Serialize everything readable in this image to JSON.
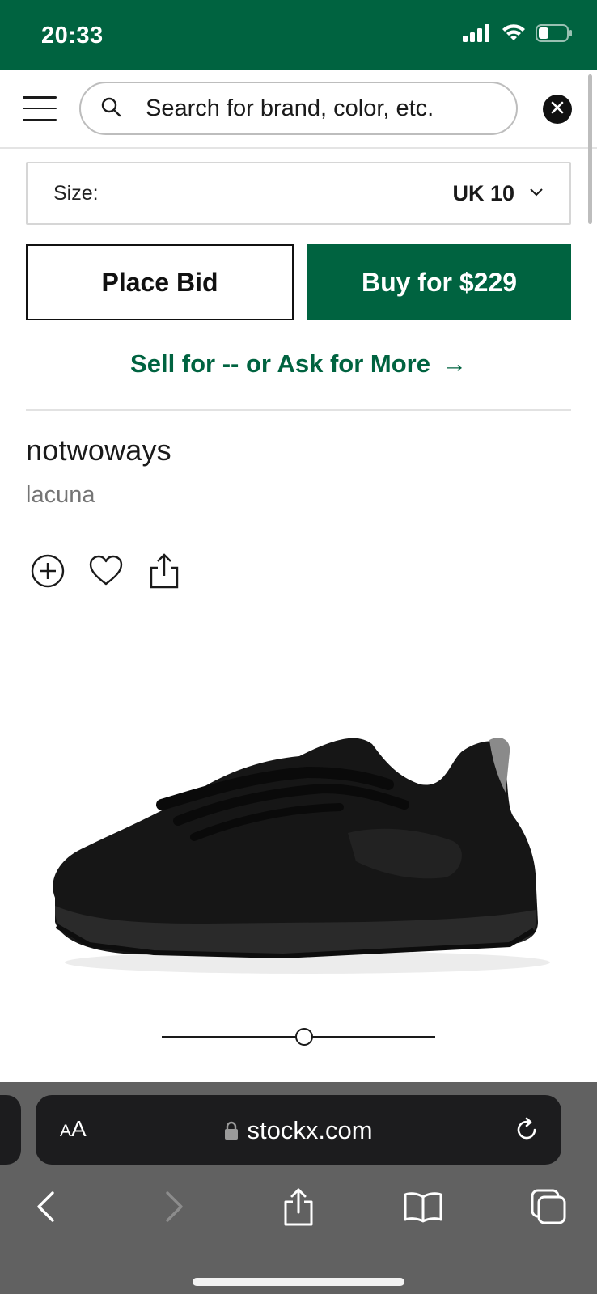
{
  "status_bar": {
    "time": "20:33",
    "icons": [
      "signal-icon",
      "wifi-icon",
      "battery-icon"
    ],
    "background": "#006340"
  },
  "header": {
    "search_placeholder": "Search for brand, color, etc.",
    "icons": [
      "menu-icon",
      "search-icon",
      "close-icon"
    ]
  },
  "size_selector": {
    "label": "Size:",
    "value": "UK 10"
  },
  "actions": {
    "place_bid_label": "Place Bid",
    "buy_label": "Buy for $229",
    "sell_link_label": "Sell for -- or Ask for More",
    "sell_arrow": "→"
  },
  "product": {
    "brand": "notwoways",
    "name": "lacuna",
    "image_description_icon": "sneaker-image",
    "gallery_position": 0.52
  },
  "product_action_icons": [
    "add-circle-icon",
    "heart-icon",
    "share-icon"
  ],
  "browser": {
    "aa_label_small": "A",
    "aa_label_large": "A",
    "url": "stockx.com",
    "toolbar_icons": [
      "back-icon",
      "forward-icon",
      "share-icon",
      "bookmarks-icon",
      "tabs-icon"
    ]
  },
  "colors": {
    "brand_green": "#006340",
    "text_primary": "#1a1a1a",
    "text_secondary": "#757575",
    "browser_chrome": "#616161",
    "url_bar": "#1c1c1e"
  }
}
